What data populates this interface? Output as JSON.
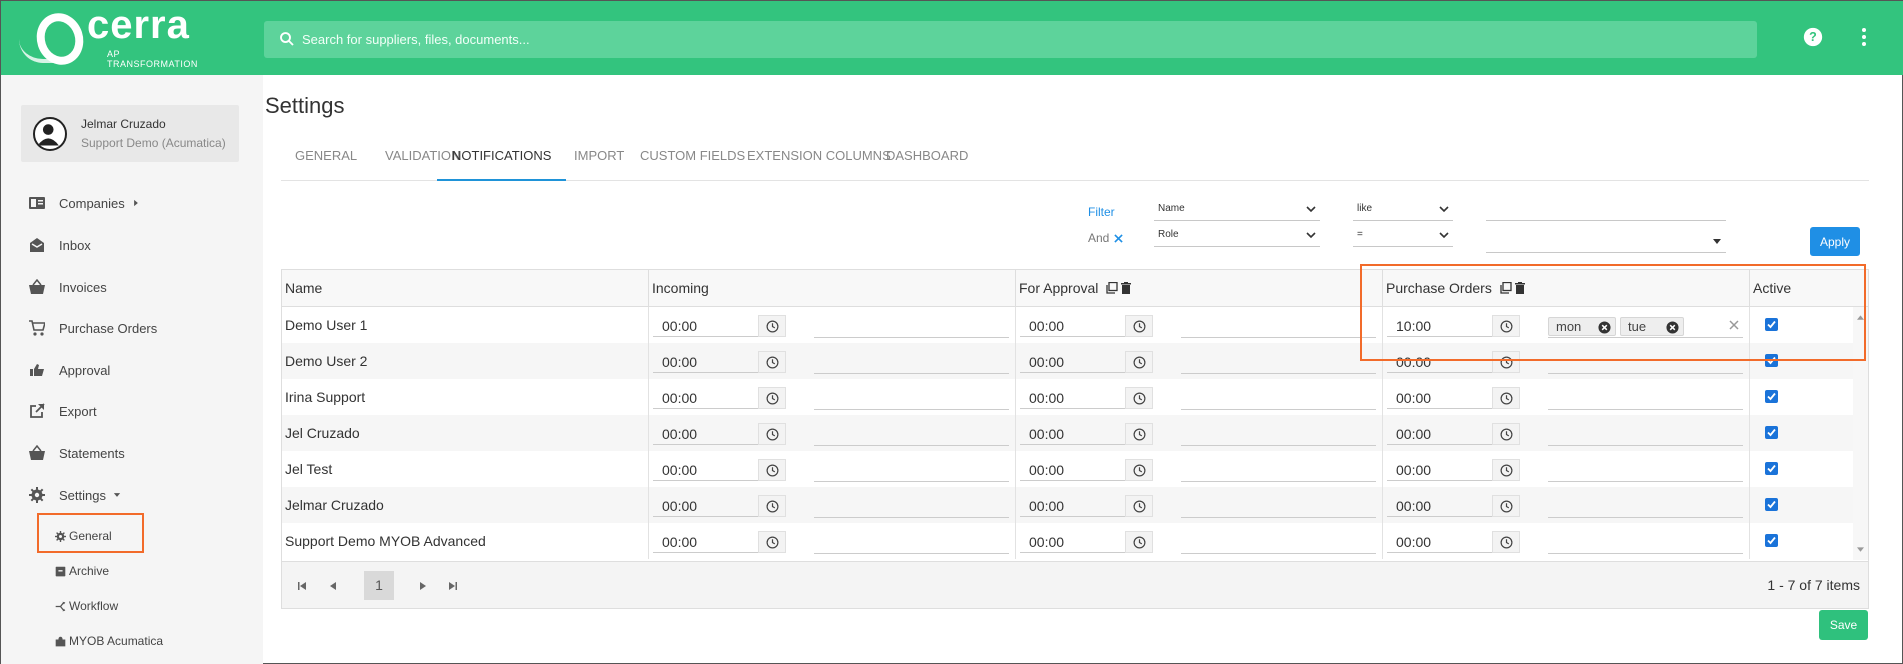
{
  "brand": {
    "name": "cerra",
    "subtitle": "AP TRANSFORMATION"
  },
  "search": {
    "placeholder": "Search for suppliers, files, documents..."
  },
  "user": {
    "name": "Jelmar Cruzado",
    "org": "Support Demo (Acumatica)"
  },
  "sidebar": {
    "items": [
      {
        "label": "Companies",
        "icon": "companies-icon"
      },
      {
        "label": "Inbox",
        "icon": "inbox-icon"
      },
      {
        "label": "Invoices",
        "icon": "basket-icon"
      },
      {
        "label": "Purchase Orders",
        "icon": "cart-icon"
      },
      {
        "label": "Approval",
        "icon": "thumbs-icon"
      },
      {
        "label": "Export",
        "icon": "export-icon"
      },
      {
        "label": "Statements",
        "icon": "basket-icon"
      },
      {
        "label": "Settings",
        "icon": "gear-icon"
      }
    ],
    "sub_items": [
      {
        "label": "General",
        "icon": "gear-icon"
      },
      {
        "label": "Archive",
        "icon": "archive-icon"
      },
      {
        "label": "Workflow",
        "icon": "workflow-icon"
      },
      {
        "label": "MYOB Acumatica",
        "icon": "puzzle-icon"
      }
    ]
  },
  "page": {
    "title": "Settings"
  },
  "tabs": [
    "GENERAL",
    "VALIDATION",
    "NOTIFICATIONS",
    "IMPORT",
    "CUSTOM FIELDS",
    "EXTENSION COLUMNS",
    "DASHBOARD"
  ],
  "active_tab": "NOTIFICATIONS",
  "filter": {
    "label": "Filter",
    "and_label": "And",
    "row1": {
      "field": "Name",
      "operator": "like",
      "value": ""
    },
    "row2": {
      "field": "Role",
      "operator": "=",
      "value": ""
    },
    "apply": "Apply"
  },
  "grid": {
    "columns": [
      "Name",
      "Incoming",
      "For Approval",
      "Purchase Orders",
      "Active"
    ],
    "rows": [
      {
        "name": "Demo User 1",
        "incoming": "00:00",
        "approval": "00:00",
        "po": "10:00",
        "days": [
          "mon",
          "tue"
        ],
        "active": true
      },
      {
        "name": "Demo User 2",
        "incoming": "00:00",
        "approval": "00:00",
        "po": "00:00",
        "days": [],
        "active": true
      },
      {
        "name": "Irina Support",
        "incoming": "00:00",
        "approval": "00:00",
        "po": "00:00",
        "days": [],
        "active": true
      },
      {
        "name": "Jel Cruzado",
        "incoming": "00:00",
        "approval": "00:00",
        "po": "00:00",
        "days": [],
        "active": true
      },
      {
        "name": "Jel Test",
        "incoming": "00:00",
        "approval": "00:00",
        "po": "00:00",
        "days": [],
        "active": true
      },
      {
        "name": "Jelmar Cruzado",
        "incoming": "00:00",
        "approval": "00:00",
        "po": "00:00",
        "days": [],
        "active": true
      },
      {
        "name": "Support Demo MYOB Advanced",
        "incoming": "00:00",
        "approval": "00:00",
        "po": "00:00",
        "days": [],
        "active": true
      }
    ]
  },
  "pager": {
    "page": "1",
    "info": "1 - 7 of 7 items"
  },
  "save": "Save",
  "colors": {
    "brand": "#33c47e",
    "accent": "#1f8fe5",
    "highlight": "#f26b2a"
  }
}
